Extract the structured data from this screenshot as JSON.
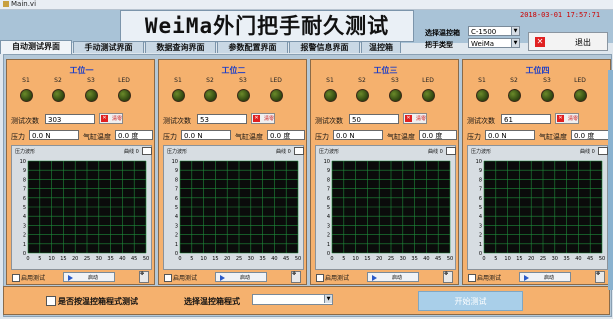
{
  "window": {
    "title": "Main.vi"
  },
  "header": {
    "title": "WeiMa外门把手耐久测试",
    "datetime": "2018-03-01 17:57:71",
    "controller_label": "选择温控箱",
    "controller_value": "C-1500",
    "handle_label": "把手类型",
    "handle_value": "WeiMa",
    "exit_label": "退出"
  },
  "tabs": [
    {
      "label": "自动测试界面",
      "active": true
    },
    {
      "label": "手动测试界面",
      "active": false
    },
    {
      "label": "数据查询界面",
      "active": false
    },
    {
      "label": "参数配置界面",
      "active": false
    },
    {
      "label": "报警信息界面",
      "active": false
    },
    {
      "label": "温控箱",
      "active": false
    }
  ],
  "stations": [
    {
      "title": "工位一",
      "count": "303",
      "pressure": "0.0 N",
      "temp": "0.0 度"
    },
    {
      "title": "工位二",
      "count": "53",
      "pressure": "0.0 N",
      "temp": "0.0 度"
    },
    {
      "title": "工位三",
      "count": "50",
      "pressure": "0.0 N",
      "temp": "0.0 度"
    },
    {
      "title": "工位四",
      "count": "61",
      "pressure": "0.0 N",
      "temp": "0.0 度"
    }
  ],
  "common": {
    "ind_labels": [
      "S1",
      "S2",
      "S3",
      "LED"
    ],
    "count_label": "测试次数",
    "clear_label": "清零",
    "pressure_label": "压力",
    "temp_label": "气缸温度",
    "chart_label": "压力波形",
    "curve_label": "曲线 0",
    "enable_label": "启用测试",
    "start_label": "启动"
  },
  "chart_data": {
    "type": "line",
    "x": [],
    "series": [],
    "xlim": [
      0,
      50
    ],
    "ylim": [
      0,
      10
    ],
    "xticks": [
      "0",
      "5",
      "10",
      "15",
      "20",
      "25",
      "30",
      "35",
      "40",
      "45",
      "50"
    ],
    "yticks": [
      "10",
      "9",
      "8",
      "7",
      "6",
      "5",
      "4",
      "3",
      "2",
      "1",
      "0"
    ],
    "grid": true
  },
  "bottom": {
    "use_controller_label": "是否按温控箱程式测试",
    "program_label": "选择温控箱程式",
    "program_value": "",
    "start_test_label": "开始测试"
  },
  "colors": {
    "panel": "#f5b16e",
    "plot_bg": "#0b0b0b",
    "grid": "#1f8a3a"
  }
}
